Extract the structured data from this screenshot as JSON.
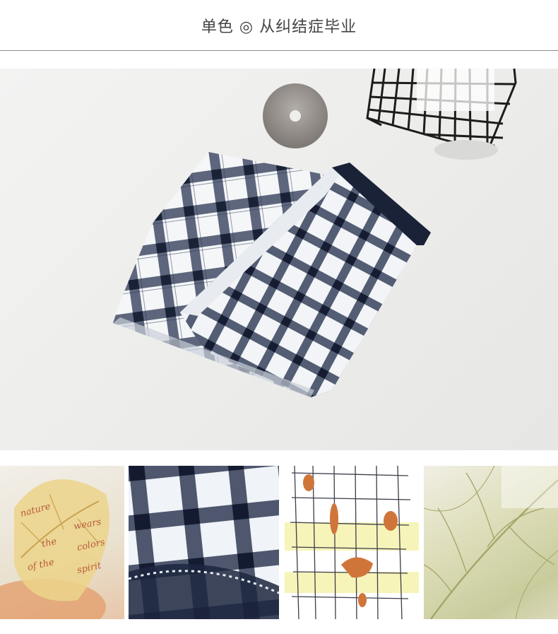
{
  "header": {
    "title": "单色 ◎ 从纠结症毕业"
  },
  "hero": {
    "image_icon": "plaid-fabric-product-photo"
  },
  "thumbnails": [
    {
      "icon": "leaf-with-handwriting-image",
      "handwriting": [
        "nature",
        "wears",
        "the",
        "colors",
        "of the",
        "spirit"
      ]
    },
    {
      "icon": "plaid-fabric-closeup-image"
    },
    {
      "icon": "grid-sketch-illustration-image"
    },
    {
      "icon": "leaf-vein-skeleton-image"
    }
  ],
  "colors": {
    "navy": "#1f2a44",
    "fabric_white": "#f4f6f8",
    "background": "#efefed",
    "divider": "#8a8a8a",
    "title_text": "#444444"
  }
}
